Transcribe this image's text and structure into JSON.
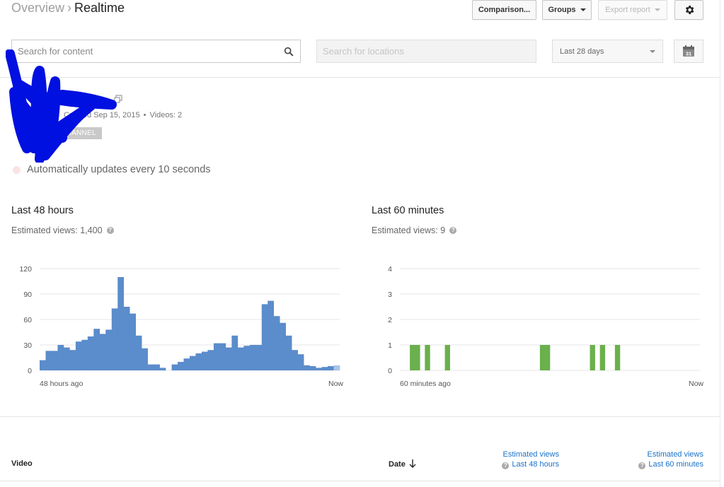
{
  "breadcrumb": {
    "parent": "Overview",
    "separator": "›",
    "current": "Realtime"
  },
  "toolbar": {
    "comparison_label": "Comparison...",
    "groups_label": "Groups",
    "export_label": "Export report",
    "settings_icon": "gear-icon"
  },
  "filters": {
    "content_placeholder": "Search for content",
    "locations_placeholder": "Search for locations",
    "date_range": "Last 28 days",
    "calendar_day": "31"
  },
  "channel": {
    "created": "Created Sep 15, 2015",
    "videos": "Videos: 2",
    "dot": "•",
    "badge": "CHANNEL"
  },
  "status": {
    "auto_update": "Automatically updates every 10 seconds",
    "accent": "#fbe3e3"
  },
  "panels": {
    "left": {
      "title": "Last 48 hours",
      "subtitle": "Estimated views: 1,400",
      "x_start": "48 hours ago",
      "x_end": "Now"
    },
    "right": {
      "title": "Last 60 minutes",
      "subtitle": "Estimated views: 9",
      "x_start": "60 minutes ago",
      "x_end": "Now"
    }
  },
  "chart_data": [
    {
      "type": "bar",
      "series": [
        {
          "color": "#5b8ccb",
          "values": [
            12,
            23,
            23,
            30,
            27,
            24,
            34,
            36,
            40,
            49,
            43,
            48,
            73,
            110,
            75,
            67,
            41,
            26,
            7,
            7,
            3,
            0,
            7,
            10,
            14,
            17,
            20,
            22,
            24,
            32,
            32,
            27,
            41,
            27,
            29,
            30,
            30,
            78,
            82,
            64,
            56,
            41,
            24,
            19,
            6,
            5,
            3,
            4,
            5,
            6
          ]
        }
      ],
      "highlight_last_color": "#aac4e8",
      "ylim": [
        0,
        120
      ],
      "yticks": [
        "120",
        "90",
        "60",
        "30",
        "0"
      ],
      "grid": true
    },
    {
      "type": "bar",
      "series": [
        {
          "color": "#6ab04c",
          "values": [
            0,
            0,
            1,
            1,
            0,
            1,
            0,
            0,
            0,
            1,
            0,
            0,
            0,
            0,
            0,
            0,
            0,
            0,
            0,
            0,
            0,
            0,
            0,
            0,
            0,
            0,
            0,
            0,
            1,
            1,
            0,
            0,
            0,
            0,
            0,
            0,
            0,
            0,
            1,
            0,
            1,
            0,
            0,
            1,
            0,
            0,
            0,
            0,
            0,
            0,
            0,
            0,
            0,
            0,
            0,
            0,
            0,
            0,
            0,
            0
          ]
        }
      ],
      "ylim": [
        0,
        4
      ],
      "yticks": [
        "4",
        "3",
        "2",
        "1",
        "0"
      ],
      "grid": true
    }
  ],
  "table": {
    "col_video": "Video",
    "col_date": "Date",
    "sort_icon": "arrow-down-icon",
    "col_views_48_top": "Estimated views",
    "col_views_48_bottom": "Last 48 hours",
    "col_views_60_top": "Estimated views",
    "col_views_60_bottom": "Last 60 minutes"
  }
}
